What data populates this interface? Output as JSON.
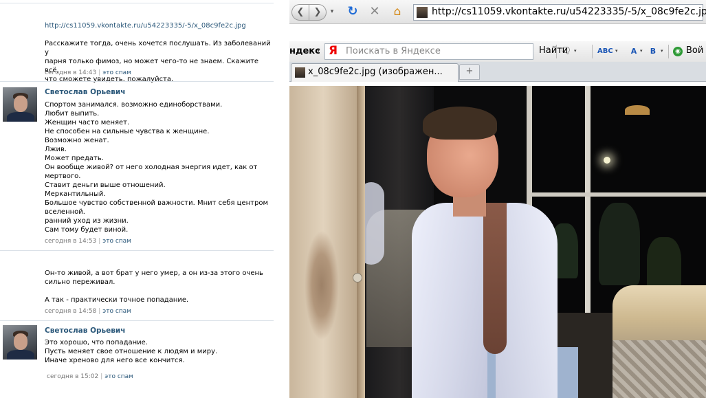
{
  "comments": [
    {
      "link": "http://cs11059.vkontakte.ru/u54223335/-5/x_08c9fe2c.jpg",
      "text": "Расскажите тогда, очень хочется послушать. Из заболеваний у\nпарня только фимоз, но может чего-то не знаем. Скажите всё,\nчто сможете увидеть, пожалуйста.",
      "time": "сегодня в 14:43",
      "spam": "это спам"
    },
    {
      "author": "Светослав Орьевич",
      "text": "Спортом занимался. возможно единоборствами.\nЛюбит выпить.\nЖенщин часто меняет.\nНе способен на сильные чувства к женщине.\nВозможно женат.\nЛжив.\nМожет предать.\nОн вообще живой? от него холодная энергия идет, как от\nмертвого.\nСтавит деньги выше отношений.\nМеркантильный.\nБольшое чувство собственной важности. Мнит себя центром\nвселенной.\nранний уход из жизни.\nСам тому будет виной.",
      "time": "сегодня в 14:53",
      "spam": "это спам"
    },
    {
      "text": "Он-то живой, а вот брат у него умер, а он из-за этого очень\nсильно переживал.\n\nА так - практически точное попадание.",
      "time": "сегодня в 14:58",
      "spam": "это спам"
    },
    {
      "author": "Светослав Орьевич",
      "text": "Это хорошо, что попадание.\nПусть меняет свое отношение к людям и миру.\nИначе хреново для него все кончится.",
      "time": "сегодня в 15:02",
      "spam": "это спам"
    }
  ],
  "browser": {
    "nav": {
      "back_icon": "back-arrow-icon",
      "forward_icon": "forward-arrow-icon",
      "back_glyph": "❮",
      "forward_glyph": "❯",
      "dropdown_glyph": "▾",
      "reload_glyph": "↻",
      "stop_glyph": "✕",
      "home_glyph": "⌂",
      "url": "http://cs11059.vkontakte.ru/u54223335/-5/x_08c9fe2c.jpg"
    },
    "search": {
      "brand": "ндекс",
      "y_glyph": "Я",
      "placeholder": "Поискать в Яндексе",
      "find_label": "Найти",
      "chat_glyph": "🗨",
      "spell_glyph": "ABC",
      "translate_glyph": "A",
      "translate2_glyph": "B",
      "login_glyph": "◉",
      "login_label": "Вой"
    },
    "tab": {
      "title": "x_08c9fe2c.jpg (изображен...",
      "newtab_glyph": "+"
    }
  },
  "colors": {
    "link": "#2b587a",
    "meta": "#777777",
    "divider": "#dae1e8"
  }
}
